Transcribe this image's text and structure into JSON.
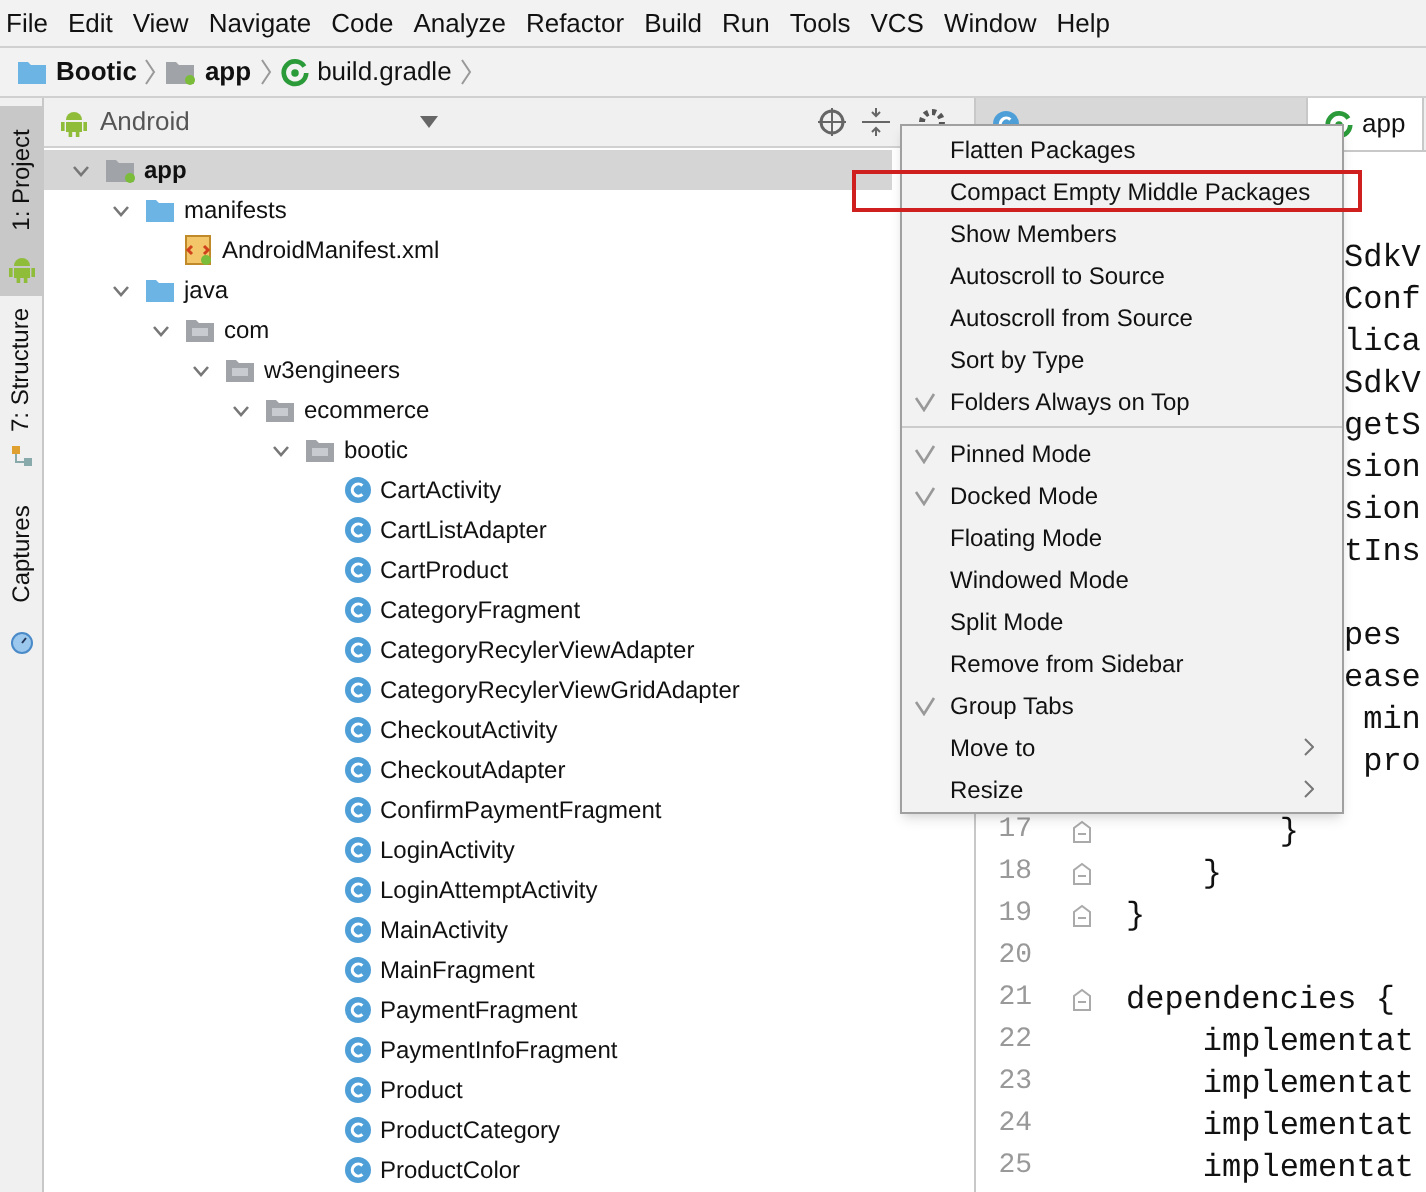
{
  "menu_bar": [
    "File",
    "Edit",
    "View",
    "Navigate",
    "Code",
    "Analyze",
    "Refactor",
    "Build",
    "Run",
    "Tools",
    "VCS",
    "Window",
    "Help"
  ],
  "breadcrumbs": [
    {
      "label": "Bootic",
      "kind": "folder"
    },
    {
      "label": "app",
      "kind": "module"
    },
    {
      "label": "build.gradle",
      "kind": "gradle"
    }
  ],
  "tool_strip": [
    {
      "label": "1: Project",
      "kind": "android",
      "selected": true
    },
    {
      "label": "7: Structure",
      "kind": "structure",
      "selected": false
    },
    {
      "label": "Captures",
      "kind": "captures",
      "selected": false
    }
  ],
  "project_panel": {
    "view": "Android",
    "tree": [
      {
        "label": "app",
        "kind": "module",
        "expanded": true,
        "selected": true,
        "children": [
          {
            "label": "manifests",
            "kind": "folder",
            "expanded": true,
            "selected": false,
            "children": [
              {
                "label": "AndroidManifest.xml",
                "kind": "manifest",
                "selected": false
              }
            ]
          },
          {
            "label": "java",
            "kind": "folder",
            "expanded": true,
            "selected": false,
            "children": [
              {
                "label": "com",
                "kind": "package",
                "expanded": true,
                "selected": false,
                "children": [
                  {
                    "label": "w3engineers",
                    "kind": "package",
                    "expanded": true,
                    "selected": false,
                    "children": [
                      {
                        "label": "ecommerce",
                        "kind": "package",
                        "expanded": true,
                        "selected": false,
                        "children": [
                          {
                            "label": "bootic",
                            "kind": "package",
                            "expanded": true,
                            "selected": false,
                            "children": [
                              {
                                "label": "CartActivity",
                                "kind": "class",
                                "selected": false
                              },
                              {
                                "label": "CartListAdapter",
                                "kind": "class",
                                "selected": false
                              },
                              {
                                "label": "CartProduct",
                                "kind": "class",
                                "selected": false
                              },
                              {
                                "label": "CategoryFragment",
                                "kind": "class",
                                "selected": false
                              },
                              {
                                "label": "CategoryRecylerViewAdapter",
                                "kind": "class",
                                "selected": false
                              },
                              {
                                "label": "CategoryRecylerViewGridAdapter",
                                "kind": "class",
                                "selected": false
                              },
                              {
                                "label": "CheckoutActivity",
                                "kind": "class",
                                "selected": false
                              },
                              {
                                "label": "CheckoutAdapter",
                                "kind": "class",
                                "selected": false
                              },
                              {
                                "label": "ConfirmPaymentFragment",
                                "kind": "class",
                                "selected": false
                              },
                              {
                                "label": "LoginActivity",
                                "kind": "class",
                                "selected": false
                              },
                              {
                                "label": "LoginAttemptActivity",
                                "kind": "class",
                                "selected": false
                              },
                              {
                                "label": "MainActivity",
                                "kind": "class",
                                "selected": false
                              },
                              {
                                "label": "MainFragment",
                                "kind": "class",
                                "selected": false
                              },
                              {
                                "label": "PaymentFragment",
                                "kind": "class",
                                "selected": false
                              },
                              {
                                "label": "PaymentInfoFragment",
                                "kind": "class",
                                "selected": false
                              },
                              {
                                "label": "Product",
                                "kind": "class",
                                "selected": false
                              },
                              {
                                "label": "ProductCategory",
                                "kind": "class",
                                "selected": false
                              },
                              {
                                "label": "ProductColor",
                                "kind": "class",
                                "selected": false
                              }
                            ]
                          }
                        ]
                      }
                    ]
                  }
                ]
              }
            ]
          }
        ]
      }
    ]
  },
  "editor": {
    "tabs": [
      {
        "kind": "class",
        "selected": false
      },
      {
        "kind": "gradle",
        "label": "app",
        "selected": true
      }
    ],
    "lines": [
      {
        "kind": "hidden"
      },
      {
        "kind": "hidden"
      },
      {
        "kind": "partial",
        "text": "SdkV"
      },
      {
        "kind": "partial",
        "text": "Conf"
      },
      {
        "kind": "partial",
        "text": "lica"
      },
      {
        "kind": "partial",
        "text": "SdkV"
      },
      {
        "kind": "partial",
        "text": "getS"
      },
      {
        "kind": "partial",
        "text": "sion"
      },
      {
        "kind": "partial",
        "text": "sion"
      },
      {
        "kind": "partial",
        "text": "tIns"
      },
      {
        "kind": "hidden"
      },
      {
        "kind": "partial",
        "text": "pes"
      },
      {
        "kind": "partial",
        "text": "ease"
      },
      {
        "kind": "partial",
        "text": " min"
      },
      {
        "kind": "partial",
        "text": " pro"
      },
      {
        "kind": "line",
        "number": "17",
        "text": "        }",
        "fold": true
      },
      {
        "kind": "line",
        "number": "18",
        "text": "    }",
        "fold": true
      },
      {
        "kind": "line",
        "number": "19",
        "text": "}",
        "fold": true
      },
      {
        "kind": "line",
        "number": "20",
        "fold": false
      },
      {
        "kind": "line",
        "number": "21",
        "text": "dependencies {",
        "fold": true
      },
      {
        "kind": "line",
        "number": "22",
        "text": "    implementat",
        "fold": false
      },
      {
        "kind": "line",
        "number": "23",
        "text": "    implementat",
        "fold": false
      },
      {
        "kind": "line",
        "number": "24",
        "text": "    implementat",
        "fold": false
      },
      {
        "kind": "line",
        "number": "25",
        "text": "    implementat",
        "fold": false
      }
    ]
  },
  "popup_menu": {
    "items": [
      {
        "kind": "item",
        "label": "Flatten Packages",
        "checked": false,
        "highlighted": false,
        "submenu": false
      },
      {
        "kind": "item",
        "label": "Compact Empty Middle Packages",
        "checked": false,
        "highlighted": true,
        "submenu": false
      },
      {
        "kind": "item",
        "label": "Show Members",
        "checked": false,
        "highlighted": false,
        "submenu": false
      },
      {
        "kind": "item",
        "label": "Autoscroll to Source",
        "checked": false,
        "highlighted": false,
        "submenu": false
      },
      {
        "kind": "item",
        "label": "Autoscroll from Source",
        "checked": false,
        "highlighted": false,
        "submenu": false
      },
      {
        "kind": "item",
        "label": "Sort by Type",
        "checked": false,
        "highlighted": false,
        "submenu": false
      },
      {
        "kind": "item",
        "label": "Folders Always on Top",
        "checked": true,
        "highlighted": false,
        "submenu": false
      },
      {
        "kind": "separator"
      },
      {
        "kind": "item",
        "label": "Pinned Mode",
        "checked": true,
        "highlighted": false,
        "submenu": false
      },
      {
        "kind": "item",
        "label": "Docked Mode",
        "checked": true,
        "highlighted": false,
        "submenu": false
      },
      {
        "kind": "item",
        "label": "Floating Mode",
        "checked": false,
        "highlighted": false,
        "submenu": false
      },
      {
        "kind": "item",
        "label": "Windowed Mode",
        "checked": false,
        "highlighted": false,
        "submenu": false
      },
      {
        "kind": "item",
        "label": "Split Mode",
        "checked": false,
        "highlighted": false,
        "submenu": false
      },
      {
        "kind": "item",
        "label": "Remove from Sidebar",
        "checked": false,
        "highlighted": false,
        "submenu": false
      },
      {
        "kind": "item",
        "label": "Group Tabs",
        "checked": true,
        "highlighted": false,
        "submenu": false
      },
      {
        "kind": "item",
        "label": "Move to",
        "checked": false,
        "highlighted": false,
        "submenu": true
      },
      {
        "kind": "item",
        "label": "Resize",
        "checked": false,
        "highlighted": false,
        "submenu": true
      }
    ]
  }
}
